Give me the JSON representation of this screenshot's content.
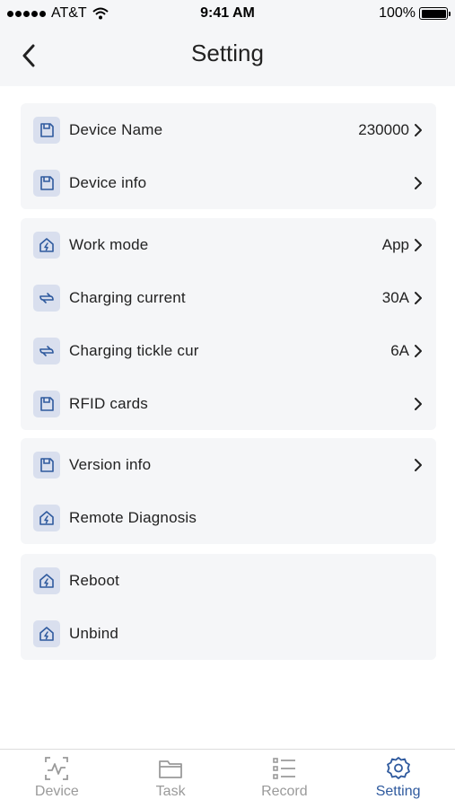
{
  "status": {
    "carrier": "AT&T",
    "time": "9:41 AM",
    "battery": "100%"
  },
  "nav": {
    "title": "Setting"
  },
  "groups": [
    {
      "rows": [
        {
          "icon": "save-icon",
          "label": "Device Name",
          "value": "230000",
          "chevron": true
        },
        {
          "icon": "save-icon",
          "label": "Device info",
          "value": "",
          "chevron": true
        }
      ]
    },
    {
      "rows": [
        {
          "icon": "house-bolt-icon",
          "label": "Work mode",
          "value": "App",
          "chevron": true
        },
        {
          "icon": "swap-arrows-icon",
          "label": "Charging current",
          "value": "30A",
          "chevron": true
        },
        {
          "icon": "swap-arrows-icon",
          "label": "Charging tickle cur",
          "value": "6A",
          "chevron": true
        },
        {
          "icon": "save-icon",
          "label": "RFID cards",
          "value": "",
          "chevron": true
        }
      ]
    },
    {
      "rows": [
        {
          "icon": "save-icon",
          "label": "Version info",
          "value": "",
          "chevron": true
        },
        {
          "icon": "house-bolt-icon",
          "label": "Remote Diagnosis",
          "value": "",
          "chevron": false
        }
      ]
    },
    {
      "rows": [
        {
          "icon": "house-bolt-icon",
          "label": "Reboot",
          "value": "",
          "chevron": false
        },
        {
          "icon": "house-bolt-icon",
          "label": "Unbind",
          "value": "",
          "chevron": false
        }
      ]
    }
  ],
  "tabs": [
    {
      "icon": "pulse-chart-icon",
      "label": "Device",
      "active": false
    },
    {
      "icon": "folder-icon",
      "label": "Task",
      "active": false
    },
    {
      "icon": "list-icon",
      "label": "Record",
      "active": false
    },
    {
      "icon": "gear-icon",
      "label": "Setting",
      "active": true
    }
  ],
  "colors": {
    "accent": "#2f5a9e",
    "icon_bg": "#d9dfee",
    "group_bg": "#f5f6f8",
    "inactive_tab": "#9a9a9a"
  }
}
